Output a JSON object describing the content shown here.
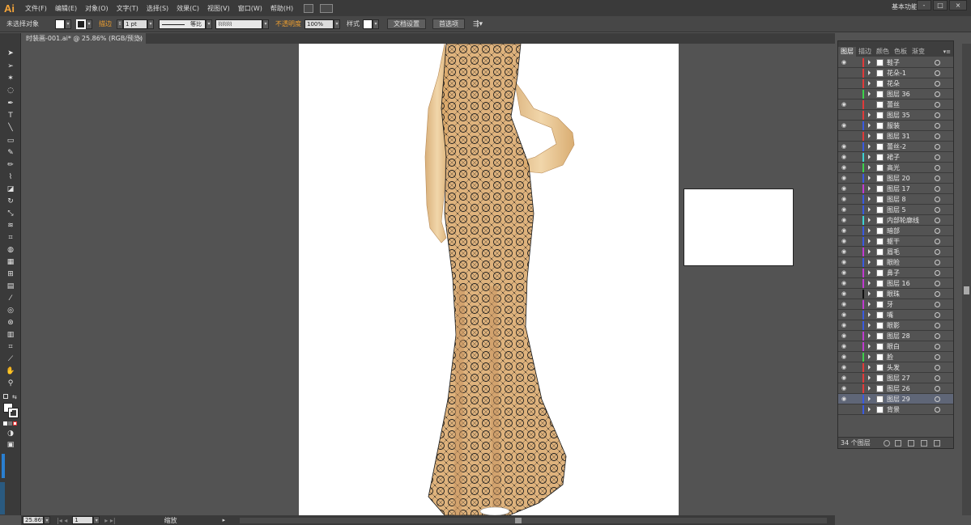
{
  "app": {
    "logo": "Ai",
    "menu": [
      "文件(F)",
      "编辑(E)",
      "对象(O)",
      "文字(T)",
      "选择(S)",
      "效果(C)",
      "视图(V)",
      "窗口(W)",
      "帮助(H)"
    ],
    "workspace": "基本功能",
    "window_controls": [
      "-",
      "□",
      "×"
    ]
  },
  "control_bar": {
    "selection_status": "未选择对象",
    "stroke_label": "描边",
    "stroke_weight": "1 pt",
    "stroke_profile": "等比",
    "opacity_label": "不透明度",
    "opacity_value": "100%",
    "style_label": "样式",
    "doc_settings_button": "文档设置",
    "preferences_button": "首选项"
  },
  "document": {
    "tab_title": "时装画-001.ai* @ 25.86% (RGB/预览)",
    "close_glyph": "×"
  },
  "status_bar": {
    "zoom": "25.86%",
    "artboard_number": "1",
    "tool_label": "缩放"
  },
  "layers_panel": {
    "tabs": [
      "图层",
      "描边",
      "颜色",
      "色板",
      "渐变"
    ],
    "menu_glyph": "▾≡",
    "layer_count_label": "34 个图层",
    "layers": [
      {
        "name": "鞋子",
        "color": "#e03a3a",
        "eye": true,
        "arrow": true,
        "selected": false
      },
      {
        "name": "花朵-1",
        "color": "#e03a3a",
        "eye": false,
        "arrow": true,
        "selected": false
      },
      {
        "name": "花朵",
        "color": "#e03a3a",
        "eye": false,
        "arrow": true,
        "selected": false
      },
      {
        "name": "图层 36",
        "color": "#3cd24a",
        "eye": false,
        "arrow": true,
        "selected": false
      },
      {
        "name": "蕾丝",
        "color": "#e03a3a",
        "eye": true,
        "arrow": false,
        "selected": false
      },
      {
        "name": "图层 35",
        "color": "#e03a3a",
        "eye": false,
        "arrow": true,
        "selected": false
      },
      {
        "name": "服装",
        "color": "#3a5ae0",
        "eye": true,
        "arrow": true,
        "selected": false
      },
      {
        "name": "图层 31",
        "color": "#e03a3a",
        "eye": false,
        "arrow": true,
        "selected": false
      },
      {
        "name": "蕾丝-2",
        "color": "#3a5ae0",
        "eye": true,
        "arrow": true,
        "selected": false
      },
      {
        "name": "裙子",
        "color": "#3cd2d2",
        "eye": true,
        "arrow": true,
        "selected": false
      },
      {
        "name": "高光",
        "color": "#3cd24a",
        "eye": true,
        "arrow": true,
        "selected": false
      },
      {
        "name": "图层 20",
        "color": "#3a5ae0",
        "eye": true,
        "arrow": true,
        "selected": false
      },
      {
        "name": "图层 17",
        "color": "#c03ad0",
        "eye": true,
        "arrow": true,
        "selected": false
      },
      {
        "name": "图层 8",
        "color": "#3a5ae0",
        "eye": true,
        "arrow": true,
        "selected": false
      },
      {
        "name": "图层 5",
        "color": "#3a5ae0",
        "eye": true,
        "arrow": true,
        "selected": false
      },
      {
        "name": "内部轮廓线",
        "color": "#3cd2d2",
        "eye": true,
        "arrow": true,
        "selected": false
      },
      {
        "name": "暗部",
        "color": "#3a5ae0",
        "eye": true,
        "arrow": true,
        "selected": false
      },
      {
        "name": "躯干",
        "color": "#3a5ae0",
        "eye": true,
        "arrow": true,
        "selected": false
      },
      {
        "name": "眉毛",
        "color": "#c03ad0",
        "eye": true,
        "arrow": true,
        "selected": false
      },
      {
        "name": "眼睑",
        "color": "#3a5ae0",
        "eye": true,
        "arrow": true,
        "selected": false
      },
      {
        "name": "鼻子",
        "color": "#c03ad0",
        "eye": true,
        "arrow": true,
        "selected": false
      },
      {
        "name": "图层 16",
        "color": "#c03ad0",
        "eye": true,
        "arrow": true,
        "selected": false
      },
      {
        "name": "眼珠",
        "color": "#111111",
        "eye": true,
        "arrow": true,
        "selected": false
      },
      {
        "name": "牙",
        "color": "#c03ad0",
        "eye": true,
        "arrow": true,
        "selected": false
      },
      {
        "name": "嘴",
        "color": "#3a5ae0",
        "eye": true,
        "arrow": true,
        "selected": false
      },
      {
        "name": "眼影",
        "color": "#3a5ae0",
        "eye": true,
        "arrow": true,
        "selected": false
      },
      {
        "name": "图层 28",
        "color": "#c03ad0",
        "eye": true,
        "arrow": true,
        "selected": false
      },
      {
        "name": "眼白",
        "color": "#c03ad0",
        "eye": true,
        "arrow": true,
        "selected": false
      },
      {
        "name": "脸",
        "color": "#3cd24a",
        "eye": true,
        "arrow": true,
        "selected": false
      },
      {
        "name": "头发",
        "color": "#e03a3a",
        "eye": true,
        "arrow": true,
        "selected": false
      },
      {
        "name": "图层 27",
        "color": "#e03a3a",
        "eye": true,
        "arrow": true,
        "selected": false
      },
      {
        "name": "图层 26",
        "color": "#e03a3a",
        "eye": true,
        "arrow": true,
        "selected": false
      },
      {
        "name": "图层 29",
        "color": "#3a5ae0",
        "eye": true,
        "arrow": true,
        "selected": true
      },
      {
        "name": "背景",
        "color": "#3a5ae0",
        "eye": false,
        "arrow": true,
        "selected": false
      }
    ]
  },
  "colors": {
    "accent": "#f0a030",
    "skin": "#e9c99a",
    "gown": "#d9a76a",
    "lace": "#1a1a1a"
  }
}
